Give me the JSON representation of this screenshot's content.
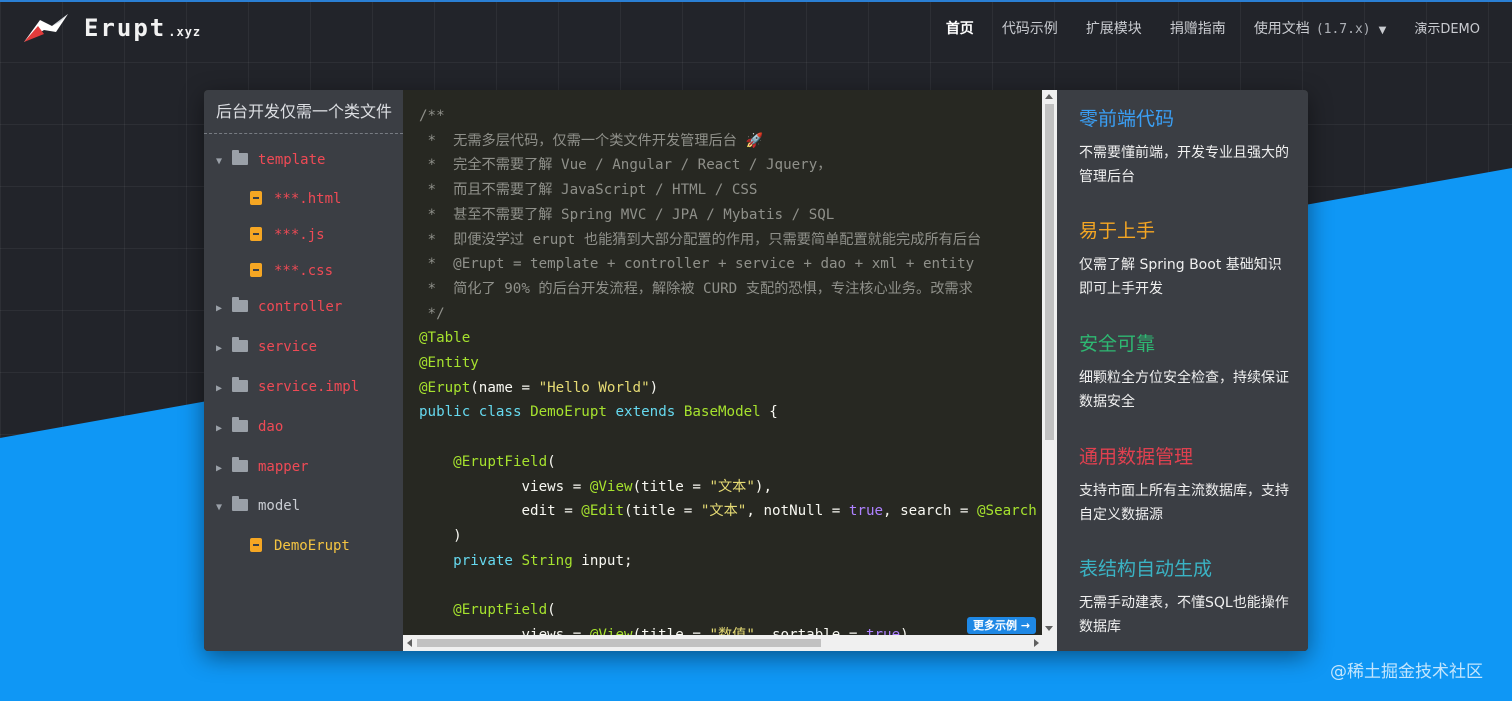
{
  "header": {
    "brand": "Erupt",
    "brand_suffix": ".xyz",
    "nav": [
      {
        "label": "首页"
      },
      {
        "label": "代码示例"
      },
      {
        "label": "扩展模块"
      },
      {
        "label": "捐赠指南"
      },
      {
        "label": "使用文档",
        "version": "(1.7.x)"
      },
      {
        "label": "演示DEMO"
      }
    ]
  },
  "tree": {
    "title": "后台开发仅需一个类文件",
    "rows": [
      {
        "type": "folder",
        "open": true,
        "label": "template"
      },
      {
        "type": "file",
        "label": "***.html"
      },
      {
        "type": "file",
        "label": "***.js"
      },
      {
        "type": "file",
        "label": "***.css"
      },
      {
        "type": "folder",
        "open": false,
        "label": "controller"
      },
      {
        "type": "folder",
        "open": false,
        "label": "service"
      },
      {
        "type": "folder",
        "open": false,
        "label": "service.impl"
      },
      {
        "type": "folder",
        "open": false,
        "label": "dao"
      },
      {
        "type": "folder",
        "open": false,
        "label": "mapper"
      },
      {
        "type": "folder",
        "open": true,
        "label": "model"
      },
      {
        "type": "file",
        "label": "DemoErupt"
      }
    ]
  },
  "code": {
    "lines": [
      "/**",
      " *  无需多层代码，仅需一个类文件开发管理后台 🚀",
      " *  完全不需要了解 Vue / Angular / React / Jquery，",
      " *  而且不需要了解 JavaScript / HTML / CSS",
      " *  甚至不需要了解 Spring MVC / JPA / Mybatis / SQL",
      " *  即便没学过 erupt 也能猜到大部分配置的作用，只需要简单配置就能完成所有后台",
      " *  @Erupt = template + controller + service + dao + xml + entity",
      " *  简化了 90% 的后台开发流程，解除被 CURD 支配的恐惧，专注核心业务。改需求",
      " */",
      "@Table",
      "@Entity",
      "@Erupt(name = \"Hello World\")",
      "public class DemoErupt extends BaseModel {",
      "",
      "    @EruptField(",
      "            views = @View(title = \"文本\"),",
      "            edit = @Edit(title = \"文本\", notNull = true, search = @Search",
      "    )",
      "    private String input;",
      "",
      "    @EruptField(",
      "            views = @View(title = \"数值\", sortable = true)"
    ],
    "more_label": "更多示例 →"
  },
  "features": [
    {
      "title": "零前端代码",
      "color": "#3a9ff5",
      "desc": "不需要懂前端，开发专业且强大的管理后台"
    },
    {
      "title": "易于上手",
      "color": "#f5a623",
      "desc": "仅需了解 Spring Boot 基础知识即可上手开发"
    },
    {
      "title": "安全可靠",
      "color": "#2eb872",
      "desc": "细颗粒全方位安全检查，持续保证数据安全"
    },
    {
      "title": "通用数据管理",
      "color": "#e0404f",
      "desc": "支持市面上所有主流数据库，支持自定义数据源"
    },
    {
      "title": "表结构自动生成",
      "color": "#3ab3c4",
      "desc": "无需手动建表，不懂SQL也能操作数据库"
    }
  ],
  "watermark": "@稀土掘金技术社区",
  "icons": {
    "logo": "erupt-bird-logo",
    "folder": "folder-icon",
    "file": "file-icon",
    "caret": "chevron-down-icon"
  }
}
